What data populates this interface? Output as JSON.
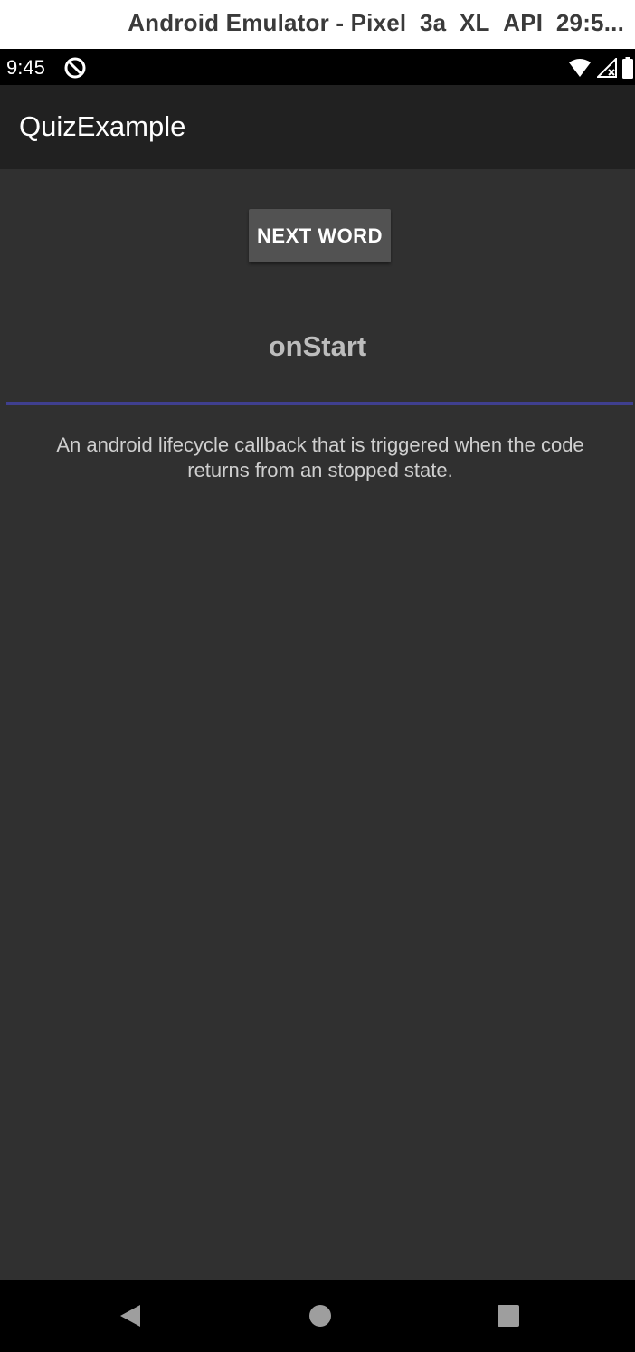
{
  "window": {
    "title": "Android Emulator - Pixel_3a_XL_API_29:5..."
  },
  "status_bar": {
    "time": "9:45",
    "icons": [
      "app-notification-icon",
      "wifi-icon",
      "cellular-signal-icon",
      "battery-icon"
    ]
  },
  "app_bar": {
    "title": "QuizExample"
  },
  "main": {
    "next_button_label": "NEXT WORD",
    "word": "onStart",
    "definition": "An android lifecycle callback that is triggered when the code returns from an stopped state."
  },
  "nav_bar": {
    "icons": [
      "back-icon",
      "home-icon",
      "recents-icon"
    ]
  },
  "colors": {
    "background": "#303030",
    "app_bar": "#212121",
    "button": "#525252",
    "divider": "#3f3f8f",
    "word_text": "#bdbdbd",
    "definition_text": "#cfcfcf"
  }
}
